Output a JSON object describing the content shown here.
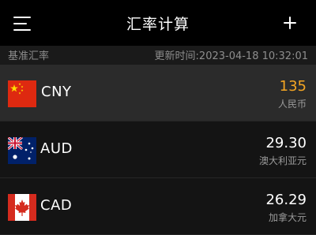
{
  "header": {
    "title": "汇率计算"
  },
  "subbar": {
    "base_label": "基准汇率",
    "update_time": "更新时间:2023-04-18 10:32:01"
  },
  "currencies": [
    {
      "code": "CNY",
      "amount": "135",
      "name": "人民币",
      "flag_icon": "china-flag-icon",
      "selected": true,
      "amount_color": "#f5a623"
    },
    {
      "code": "AUD",
      "amount": "29.30",
      "name": "澳大利亚元",
      "flag_icon": "australia-flag-icon",
      "selected": false
    },
    {
      "code": "CAD",
      "amount": "26.29",
      "name": "加拿大元",
      "flag_icon": "canada-flag-icon",
      "selected": false
    }
  ],
  "colors": {
    "background": "#000000",
    "selected_row": "#2b2b2b",
    "row": "#141414",
    "accent": "#f5a623"
  }
}
